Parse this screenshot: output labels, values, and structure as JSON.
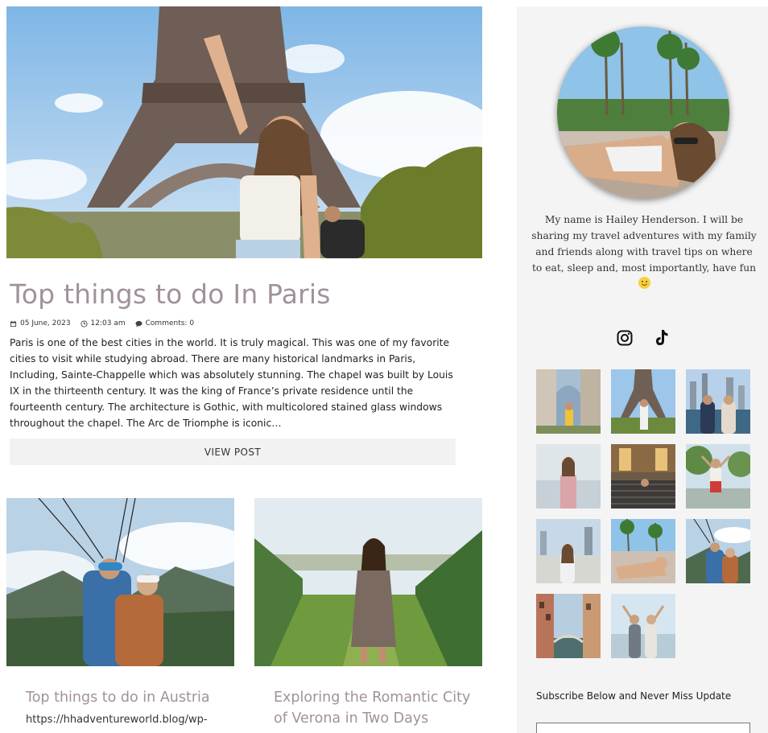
{
  "featured_post": {
    "title": "Top things to do In Paris",
    "date": "05 June, 2023",
    "time": "12:03 am",
    "comments": "Comments: 0",
    "excerpt": "Paris is one of the best cities in the world. It is truly magical. This was one of my favorite cities to visit while studying abroad. There are many historical landmarks in Paris, Including, Sainte-Chappelle which was absolutely stunning. The chapel was built by Louis IX in the thirteenth century. It was the king of France’s private residence until the fourteenth century. The architecture is Gothic, with multicolored stained glass windows throughout the chapel. The Arc de Triomphe is iconic…",
    "button_label": "VIEW POST"
  },
  "cards": [
    {
      "title": "Top things to do in Austria",
      "link": "https://hhadventureworld.blog/wp-"
    },
    {
      "title": "Exploring the Romantic City of Verona in Two Days",
      "link": ""
    }
  ],
  "sidebar": {
    "bio": "My name is Hailey Henderson. I will be sharing my travel adventures with my family and friends along with travel tips on where to eat, sleep and, most importantly, have fun",
    "social": [
      {
        "icon": "instagram-icon"
      },
      {
        "icon": "tiktok-icon"
      }
    ],
    "subscribe_heading": "Subscribe Below and Never Miss Update",
    "subscribe_placeholder": ""
  },
  "colors": {
    "title_mauve": "#a1919c",
    "sidebar_bg": "#f4f4f4",
    "button_bg": "#f2f2f2"
  }
}
